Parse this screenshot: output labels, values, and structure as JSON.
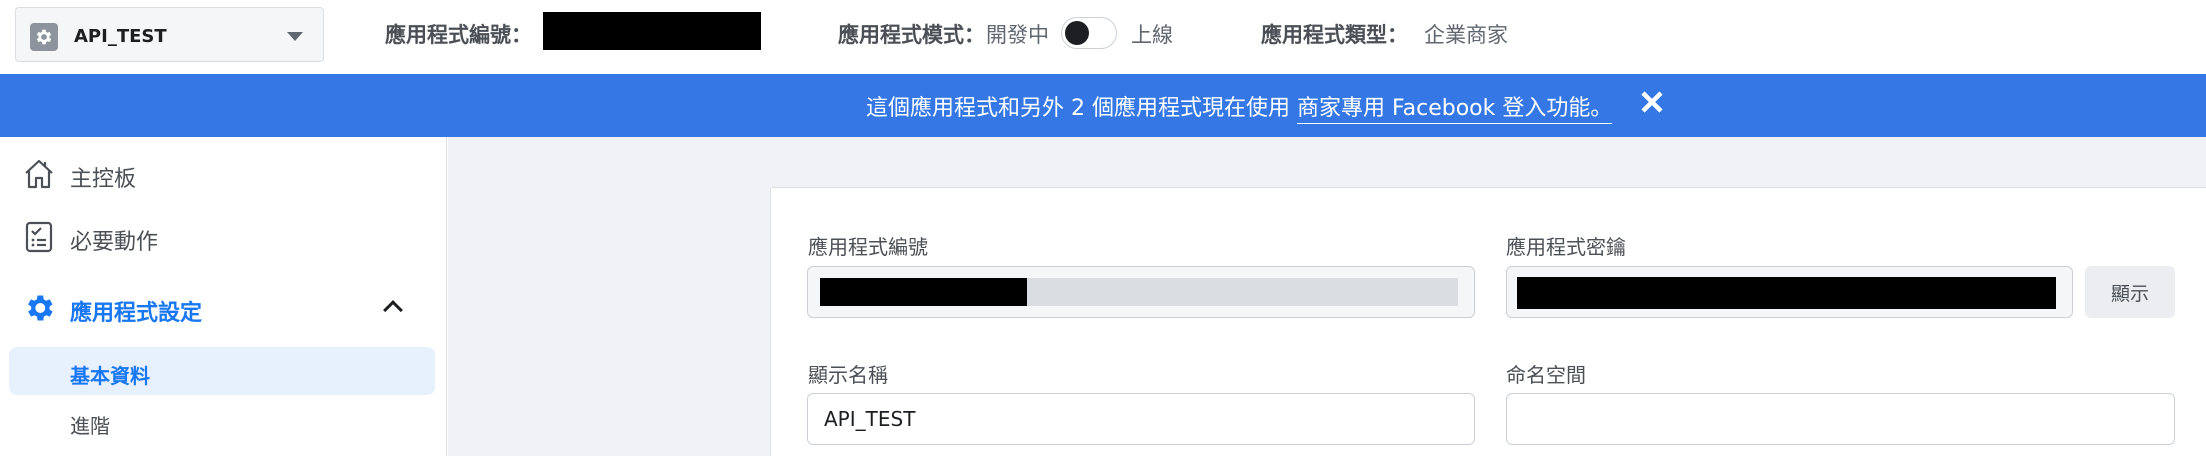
{
  "topbar": {
    "app_name": "API_TEST",
    "app_id_label": "應用程式編號：",
    "app_mode_label": "應用程式模式：",
    "app_mode_dev": "開發中",
    "app_mode_live": "上線",
    "app_mode_live_enabled": false,
    "app_type_label": "應用程式類型：",
    "app_type_value": "企業商家"
  },
  "banner": {
    "text_prefix": "這個應用程式和另外 2 個應用程式現在使用 ",
    "link_text": "商家專用 Facebook 登入功能。",
    "background": "#3578e5"
  },
  "sidebar": {
    "items": [
      {
        "label": "主控板",
        "icon": "home-icon"
      },
      {
        "label": "必要動作",
        "icon": "checklist-icon"
      },
      {
        "label": "應用程式設定",
        "icon": "gear-icon",
        "expanded": true
      }
    ],
    "sub_items": [
      {
        "label": "基本資料",
        "selected": true
      },
      {
        "label": "進階",
        "selected": false
      }
    ]
  },
  "form": {
    "app_id_label": "應用程式編號",
    "app_secret_label": "應用程式密鑰",
    "show_button": "顯示",
    "display_name_label": "顯示名稱",
    "display_name_value": "API_TEST",
    "namespace_label": "命名空間",
    "namespace_value": ""
  },
  "colors": {
    "accent": "#1877f2",
    "banner": "#3578e5",
    "page_bg": "#f0f2f5"
  }
}
